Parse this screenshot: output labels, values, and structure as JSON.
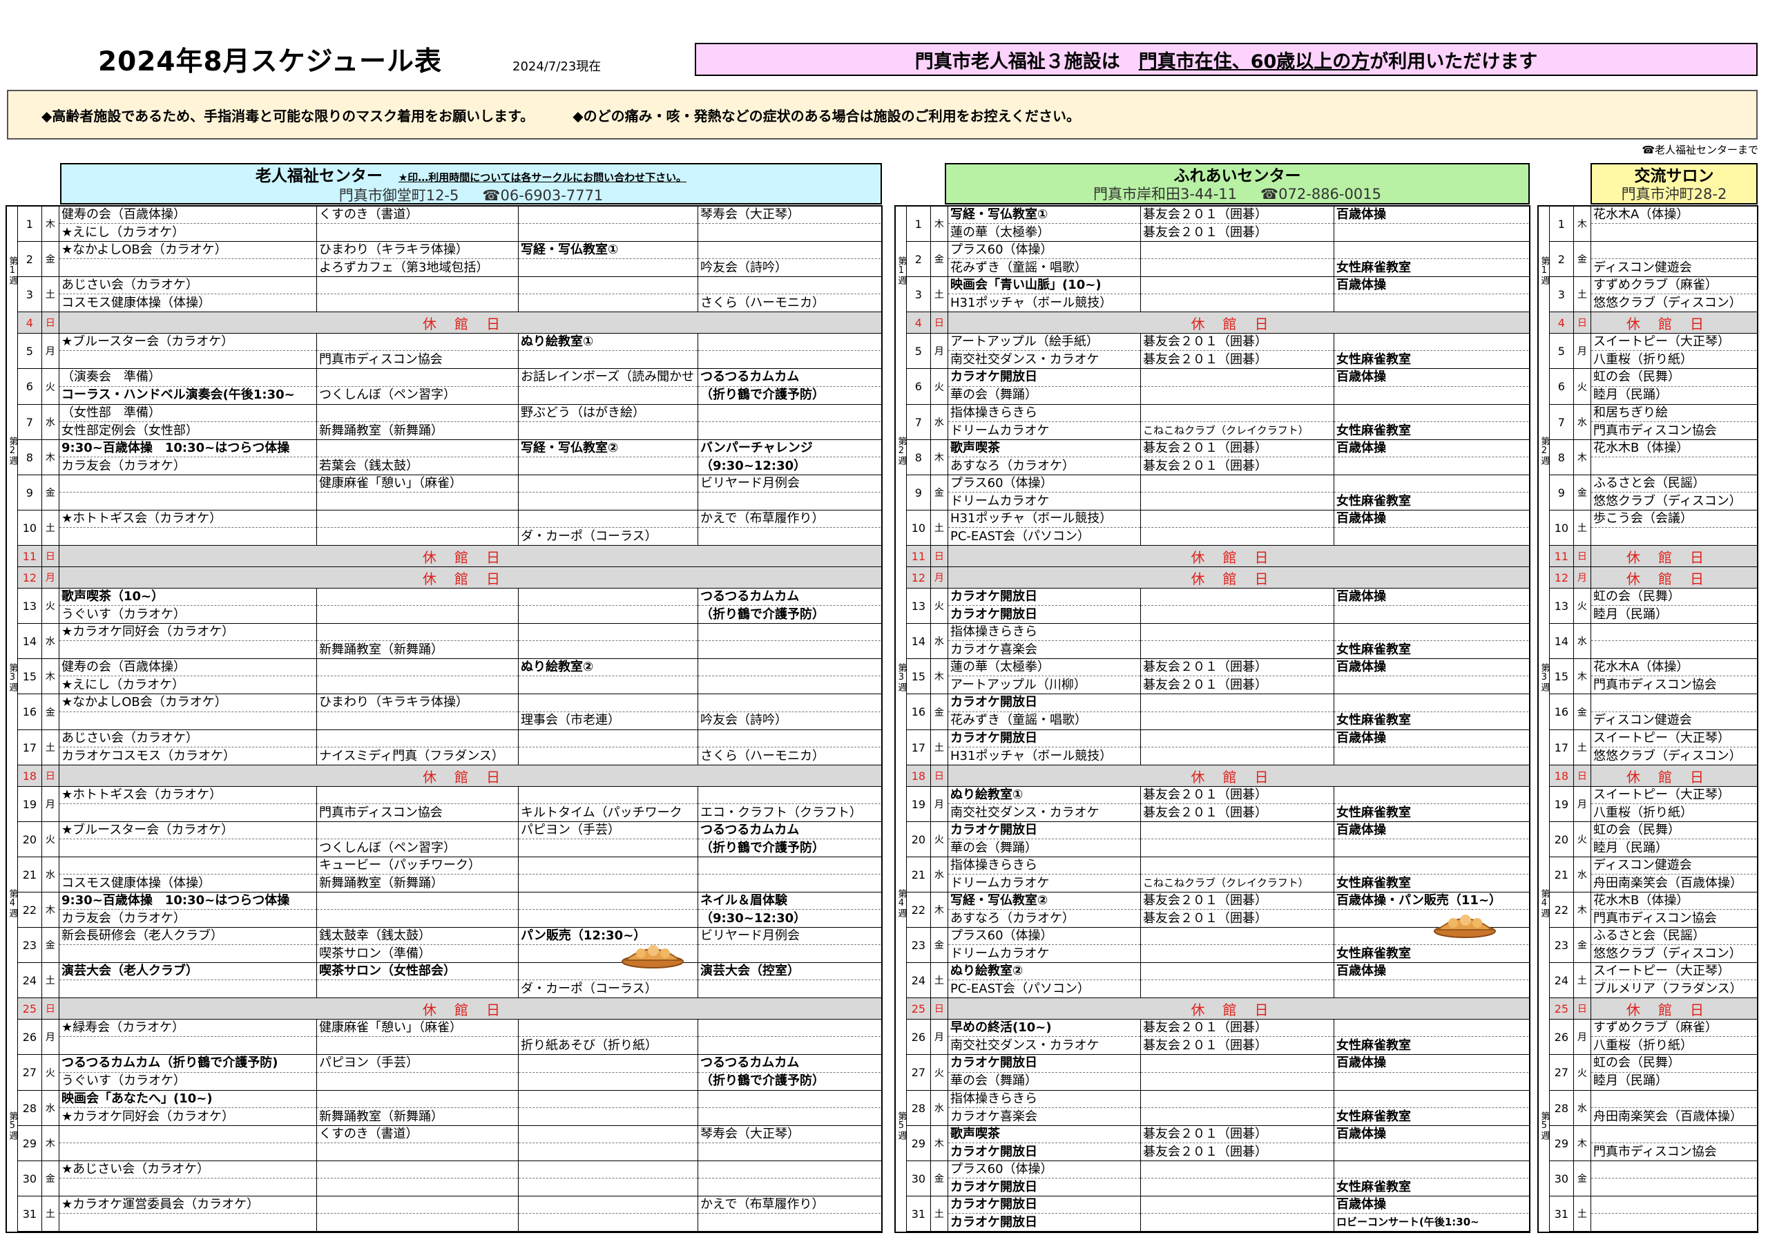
{
  "title": "2024年8月スケジュール表",
  "as_of": "2024/7/23現在",
  "banner": {
    "pre": "門真市老人福祉３施設は　",
    "u": "門真市在住、60歳以上の方",
    "post": "が利用いただけます"
  },
  "notice": {
    "left": "◆高齢者施設であるため、手指消毒と可能な限りのマスク着用をお願いします。",
    "right": "◆のどの痛み・咳・発熱などの症状のある場合は施設のご利用をお控えください。"
  },
  "tel_note": "☎老人福祉センターまで",
  "closed_label": "休館日",
  "week_labels": [
    "第1週",
    "第2週",
    "第3週",
    "第4週",
    "第5週"
  ],
  "centers": [
    {
      "name": "老人福祉センター",
      "note": "★印…利用時間については各サークルにお問い合わせ下さい。",
      "address": "門真市御堂町12-5",
      "tel": "☎06-6903-7771"
    },
    {
      "name": "ふれあいセンター",
      "address": "門真市岸和田3-44-11",
      "tel": "☎072-886-0015"
    },
    {
      "name": "交流サロン",
      "address": "門真市沖町28-2"
    }
  ],
  "days": [
    {
      "d": "1",
      "w": "木"
    },
    {
      "d": "2",
      "w": "金"
    },
    {
      "d": "3",
      "w": "土"
    },
    {
      "d": "4",
      "w": "日",
      "closed": true
    },
    {
      "d": "5",
      "w": "月"
    },
    {
      "d": "6",
      "w": "火"
    },
    {
      "d": "7",
      "w": "水"
    },
    {
      "d": "8",
      "w": "木"
    },
    {
      "d": "9",
      "w": "金"
    },
    {
      "d": "10",
      "w": "土"
    },
    {
      "d": "11",
      "w": "日",
      "closed": true
    },
    {
      "d": "12",
      "w": "月",
      "closed": true
    },
    {
      "d": "13",
      "w": "火"
    },
    {
      "d": "14",
      "w": "水"
    },
    {
      "d": "15",
      "w": "木"
    },
    {
      "d": "16",
      "w": "金"
    },
    {
      "d": "17",
      "w": "土"
    },
    {
      "d": "18",
      "w": "日",
      "closed": true
    },
    {
      "d": "19",
      "w": "月"
    },
    {
      "d": "20",
      "w": "火"
    },
    {
      "d": "21",
      "w": "水"
    },
    {
      "d": "22",
      "w": "木"
    },
    {
      "d": "23",
      "w": "金"
    },
    {
      "d": "24",
      "w": "土"
    },
    {
      "d": "25",
      "w": "日",
      "closed": true
    },
    {
      "d": "26",
      "w": "月"
    },
    {
      "d": "27",
      "w": "火"
    },
    {
      "d": "28",
      "w": "水"
    },
    {
      "d": "29",
      "w": "木"
    },
    {
      "d": "30",
      "w": "金"
    },
    {
      "d": "31",
      "w": "土"
    }
  ],
  "rojin": [
    [
      [
        "健寿の会（百歳体操）",
        "★えにし（カラオケ）"
      ],
      [
        "くすのき（書道）",
        ""
      ],
      [
        "",
        ""
      ],
      [
        "琴寿会（大正琴）",
        ""
      ]
    ],
    [
      [
        "★なかよしOB会（カラオケ）",
        ""
      ],
      [
        "ひまわり（キラキラ体操）",
        "よろずカフェ（第3地域包括）"
      ],
      [
        "写経・写仏教室①",
        ""
      ],
      [
        "",
        "吟友会（詩吟）"
      ]
    ],
    [
      [
        "あじさい会（カラオケ）",
        "コスモス健康体操（体操）"
      ],
      [
        "",
        ""
      ],
      [
        "",
        ""
      ],
      [
        "",
        "さくら（ハーモニカ）"
      ]
    ],
    null,
    [
      [
        "★ブルースター会（カラオケ）",
        ""
      ],
      [
        "",
        "門真市ディスコン協会"
      ],
      [
        "ぬり絵教室①",
        ""
      ],
      [
        "",
        ""
      ]
    ],
    [
      [
        "（演奏会　準備）",
        "コーラス・ハンドベル演奏会(午後1:30~"
      ],
      [
        "",
        "つくしんぼ（ペン習字）"
      ],
      [
        "お話レインボーズ（読み聞かせ",
        ""
      ],
      [
        "つるつるカムカム",
        "（折り鶴で介護予防）"
      ]
    ],
    [
      [
        "（女性部　準備）",
        "女性部定例会（女性部）"
      ],
      [
        "",
        "新舞踊教室（新舞踊）"
      ],
      [
        "野ぶどう（はがき絵）",
        ""
      ],
      [
        "",
        ""
      ]
    ],
    [
      [
        "9:30~百歳体操　10:30~はつらつ体操",
        "カラ友会（カラオケ）"
      ],
      [
        "",
        "若葉会（銭太鼓）"
      ],
      [
        "写経・写仏教室②",
        ""
      ],
      [
        "バンパーチャレンジ",
        "（9:30~12:30）"
      ]
    ],
    [
      [
        "",
        ""
      ],
      [
        "健康麻雀「憩い」（麻雀）",
        ""
      ],
      [
        "",
        ""
      ],
      [
        "ビリヤード月例会",
        ""
      ]
    ],
    [
      [
        "★ホトトギス会（カラオケ）",
        ""
      ],
      [
        "",
        ""
      ],
      [
        "",
        "ダ・カーポ（コーラス）"
      ],
      [
        "かえで（布草履作り）",
        ""
      ]
    ],
    null,
    null,
    [
      [
        "歌声喫茶（10~）",
        "うぐいす（カラオケ）"
      ],
      [
        "",
        ""
      ],
      [
        "",
        ""
      ],
      [
        "つるつるカムカム",
        "（折り鶴で介護予防）"
      ]
    ],
    [
      [
        "★カラオケ同好会（カラオケ）",
        ""
      ],
      [
        "",
        "新舞踊教室（新舞踊）"
      ],
      [
        "",
        ""
      ],
      [
        "",
        ""
      ]
    ],
    [
      [
        "健寿の会（百歳体操）",
        "★えにし（カラオケ）"
      ],
      [
        "",
        ""
      ],
      [
        "ぬり絵教室②",
        ""
      ],
      [
        "",
        ""
      ]
    ],
    [
      [
        "★なかよしOB会（カラオケ）",
        ""
      ],
      [
        "ひまわり（キラキラ体操）",
        ""
      ],
      [
        "",
        "理事会（市老連）"
      ],
      [
        "",
        "吟友会（詩吟）"
      ]
    ],
    [
      [
        "あじさい会（カラオケ）",
        "カラオケコスモス（カラオケ）"
      ],
      [
        "",
        "ナイスミディ門真（フラダンス）"
      ],
      [
        "",
        ""
      ],
      [
        "",
        "さくら（ハーモニカ）"
      ]
    ],
    null,
    [
      [
        "★ホトトギス会（カラオケ）",
        ""
      ],
      [
        "",
        "門真市ディスコン協会"
      ],
      [
        "",
        "キルトタイム（パッチワーク"
      ],
      [
        "",
        "エコ・クラフト（クラフト）"
      ]
    ],
    [
      [
        "★ブルースター会（カラオケ）",
        ""
      ],
      [
        "",
        "つくしんぼ（ペン習字）"
      ],
      [
        "パピヨン（手芸）",
        ""
      ],
      [
        "つるつるカムカム",
        "（折り鶴で介護予防）"
      ]
    ],
    [
      [
        "",
        "コスモス健康体操（体操）"
      ],
      [
        "キュービー（パッチワーク）",
        "新舞踊教室（新舞踊）"
      ],
      [
        "",
        ""
      ],
      [
        "",
        ""
      ]
    ],
    [
      [
        "9:30~百歳体操　10:30~はつらつ体操",
        "カラ友会（カラオケ）"
      ],
      [
        "",
        ""
      ],
      [
        "",
        ""
      ],
      [
        "ネイル＆眉体験",
        "（9:30~12:30）"
      ]
    ],
    [
      [
        "新会長研修会（老人クラブ）",
        ""
      ],
      [
        "銭太鼓幸（銭太鼓）",
        "喫茶サロン（準備）"
      ],
      [
        "パン販売（12:30~）",
        ""
      ],
      [
        "ビリヤード月例会",
        ""
      ]
    ],
    [
      [
        "演芸大会（老人クラブ）",
        ""
      ],
      [
        "喫茶サロン（女性部会）",
        ""
      ],
      [
        "",
        "ダ・カーポ（コーラス）"
      ],
      [
        "演芸大会（控室）",
        ""
      ]
    ],
    null,
    [
      [
        "★緑寿会（カラオケ）",
        ""
      ],
      [
        "健康麻雀「憩い」（麻雀）",
        ""
      ],
      [
        "",
        "折り紙あそび（折り紙）"
      ],
      [
        "",
        ""
      ]
    ],
    [
      [
        "つるつるカムカム（折り鶴で介護予防)",
        "うぐいす（カラオケ）"
      ],
      [
        "パピヨン（手芸）",
        ""
      ],
      [
        "",
        ""
      ],
      [
        "つるつるカムカム",
        "（折り鶴で介護予防）"
      ]
    ],
    [
      [
        "映画会「あなたへ」(10~)",
        "★カラオケ同好会（カラオケ）"
      ],
      [
        "",
        "新舞踊教室（新舞踊）"
      ],
      [
        "",
        ""
      ],
      [
        "",
        ""
      ]
    ],
    [
      [
        "",
        ""
      ],
      [
        "くすのき（書道）",
        ""
      ],
      [
        "",
        ""
      ],
      [
        "琴寿会（大正琴）",
        ""
      ]
    ],
    [
      [
        "★あじさい会（カラオケ）",
        ""
      ],
      [
        "",
        ""
      ],
      [
        "",
        ""
      ],
      [
        "",
        ""
      ]
    ],
    [
      [
        "★カラオケ運営委員会（カラオケ）",
        ""
      ],
      [
        "",
        ""
      ],
      [
        "",
        ""
      ],
      [
        "かえで（布草履作り）",
        ""
      ]
    ]
  ],
  "fureai": [
    [
      [
        "写経・写仏教室①",
        "蓮の華（太極拳）"
      ],
      [
        "碁友会２０１（囲碁）",
        "碁友会２０１（囲碁）"
      ],
      [
        "百歳体操",
        ""
      ]
    ],
    [
      [
        "プラス60（体操）",
        "花みずき（童謡・唱歌）"
      ],
      [
        "",
        ""
      ],
      [
        "",
        "女性麻雀教室"
      ]
    ],
    [
      [
        "映画会「青い山脈」(10~)",
        "H31ポッチャ（ボール競技）"
      ],
      [
        "",
        ""
      ],
      [
        "百歳体操",
        ""
      ]
    ],
    null,
    [
      [
        "アートアップル（絵手紙）",
        "南交社交ダンス・カラオケ"
      ],
      [
        "碁友会２０１（囲碁）",
        "碁友会２０１（囲碁）"
      ],
      [
        "",
        "女性麻雀教室"
      ]
    ],
    [
      [
        "カラオケ開放日",
        "華の会（舞踊）"
      ],
      [
        "",
        ""
      ],
      [
        "百歳体操",
        ""
      ]
    ],
    [
      [
        "指体操きらきら",
        "ドリームカラオケ"
      ],
      [
        "",
        "こねこねクラブ（クレイクラフト）"
      ],
      [
        "",
        "女性麻雀教室"
      ]
    ],
    [
      [
        "歌声喫茶",
        "あすなろ（カラオケ）"
      ],
      [
        "碁友会２０１（囲碁）",
        "碁友会２０１（囲碁）"
      ],
      [
        "百歳体操",
        ""
      ]
    ],
    [
      [
        "プラス60（体操）",
        "ドリームカラオケ"
      ],
      [
        "",
        ""
      ],
      [
        "",
        "女性麻雀教室"
      ]
    ],
    [
      [
        "H31ポッチャ（ボール競技）",
        "PC-EAST会（パソコン）"
      ],
      [
        "",
        ""
      ],
      [
        "百歳体操",
        ""
      ]
    ],
    null,
    null,
    [
      [
        "カラオケ開放日",
        "カラオケ開放日"
      ],
      [
        "",
        ""
      ],
      [
        "百歳体操",
        ""
      ]
    ],
    [
      [
        "指体操きらきら",
        "カラオケ喜楽会"
      ],
      [
        "",
        ""
      ],
      [
        "",
        "女性麻雀教室"
      ]
    ],
    [
      [
        "蓮の華（太極拳）",
        "アートアップル（川柳）"
      ],
      [
        "碁友会２０１（囲碁）",
        "碁友会２０１（囲碁）"
      ],
      [
        "百歳体操",
        ""
      ]
    ],
    [
      [
        "カラオケ開放日",
        "花みずき（童謡・唱歌）"
      ],
      [
        "",
        ""
      ],
      [
        "",
        "女性麻雀教室"
      ]
    ],
    [
      [
        "カラオケ開放日",
        "H31ポッチャ（ボール競技）"
      ],
      [
        "",
        ""
      ],
      [
        "百歳体操",
        ""
      ]
    ],
    null,
    [
      [
        "ぬり絵教室①",
        "南交社交ダンス・カラオケ"
      ],
      [
        "碁友会２０１（囲碁）",
        "碁友会２０１（囲碁）"
      ],
      [
        "",
        "女性麻雀教室"
      ]
    ],
    [
      [
        "カラオケ開放日",
        "華の会（舞踊）"
      ],
      [
        "",
        ""
      ],
      [
        "百歳体操",
        ""
      ]
    ],
    [
      [
        "指体操きらきら",
        "ドリームカラオケ"
      ],
      [
        "",
        "こねこねクラブ（クレイクラフト）"
      ],
      [
        "",
        "女性麻雀教室"
      ]
    ],
    [
      [
        "写経・写仏教室②",
        "あすなろ（カラオケ）"
      ],
      [
        "碁友会２０１（囲碁）",
        "碁友会２０１（囲碁）"
      ],
      [
        "百歳体操・パン販売（11~）",
        ""
      ]
    ],
    [
      [
        "プラス60（体操）",
        "ドリームカラオケ"
      ],
      [
        "",
        ""
      ],
      [
        "",
        "女性麻雀教室"
      ]
    ],
    [
      [
        "ぬり絵教室②",
        "PC-EAST会（パソコン）"
      ],
      [
        "",
        ""
      ],
      [
        "百歳体操",
        ""
      ]
    ],
    null,
    [
      [
        "早めの終活(10~)",
        "南交社交ダンス・カラオケ"
      ],
      [
        "碁友会２０１（囲碁）",
        "碁友会２０１（囲碁）"
      ],
      [
        "",
        "女性麻雀教室"
      ]
    ],
    [
      [
        "カラオケ開放日",
        "華の会（舞踊）"
      ],
      [
        "",
        ""
      ],
      [
        "百歳体操",
        ""
      ]
    ],
    [
      [
        "指体操きらきら",
        "カラオケ喜楽会"
      ],
      [
        "",
        ""
      ],
      [
        "",
        "女性麻雀教室"
      ]
    ],
    [
      [
        "歌声喫茶",
        "カラオケ開放日"
      ],
      [
        "碁友会２０１（囲碁）",
        "碁友会２０１（囲碁）"
      ],
      [
        "百歳体操",
        ""
      ]
    ],
    [
      [
        "プラス60（体操）",
        "カラオケ開放日"
      ],
      [
        "",
        ""
      ],
      [
        "",
        "女性麻雀教室"
      ]
    ],
    [
      [
        "カラオケ開放日",
        "カラオケ開放日"
      ],
      [
        "",
        ""
      ],
      [
        "百歳体操",
        "ロビーコンサート(午後1:30~"
      ]
    ]
  ],
  "salon": [
    [
      "花水木A（体操）",
      ""
    ],
    [
      "",
      "ディスコン健遊会"
    ],
    [
      "すずめクラブ（麻雀）",
      "悠悠クラブ（ディスコン）"
    ],
    null,
    [
      "スイートピー（大正琴）",
      "八重桜（折り紙）"
    ],
    [
      "虹の会（民舞）",
      "睦月（民踊）"
    ],
    [
      "和居ちぎり絵",
      "門真市ディスコン協会"
    ],
    [
      "花水木B（体操）",
      ""
    ],
    [
      "ふるさと会（民謡）",
      "悠悠クラブ（ディスコン）"
    ],
    [
      "歩こう会（会議）",
      ""
    ],
    null,
    null,
    [
      "虹の会（民舞）",
      "睦月（民踊）"
    ],
    [
      "",
      ""
    ],
    [
      "花水木A（体操）",
      "門真市ディスコン協会"
    ],
    [
      "",
      "ディスコン健遊会"
    ],
    [
      "スイートピー（大正琴）",
      "悠悠クラブ（ディスコン）"
    ],
    null,
    [
      "スイートピー（大正琴）",
      "八重桜（折り紙）"
    ],
    [
      "虹の会（民舞）",
      "睦月（民踊）"
    ],
    [
      "ディスコン健遊会",
      "舟田南楽笑会（百歳体操）"
    ],
    [
      "花水木B（体操）",
      "門真市ディスコン協会"
    ],
    [
      "ふるさと会（民謡）",
      "悠悠クラブ（ディスコン）"
    ],
    [
      "スイートピー（大正琴）",
      "ブルメリア（フラダンス）"
    ],
    null,
    [
      "すずめクラブ（麻雀）",
      "八重桜（折り紙）"
    ],
    [
      "虹の会（民舞）",
      "睦月（民踊）"
    ],
    [
      "",
      "舟田南楽笑会（百歳体操）"
    ],
    [
      "",
      "門真市ディスコン協会"
    ],
    [
      "",
      ""
    ],
    [
      "",
      ""
    ]
  ]
}
